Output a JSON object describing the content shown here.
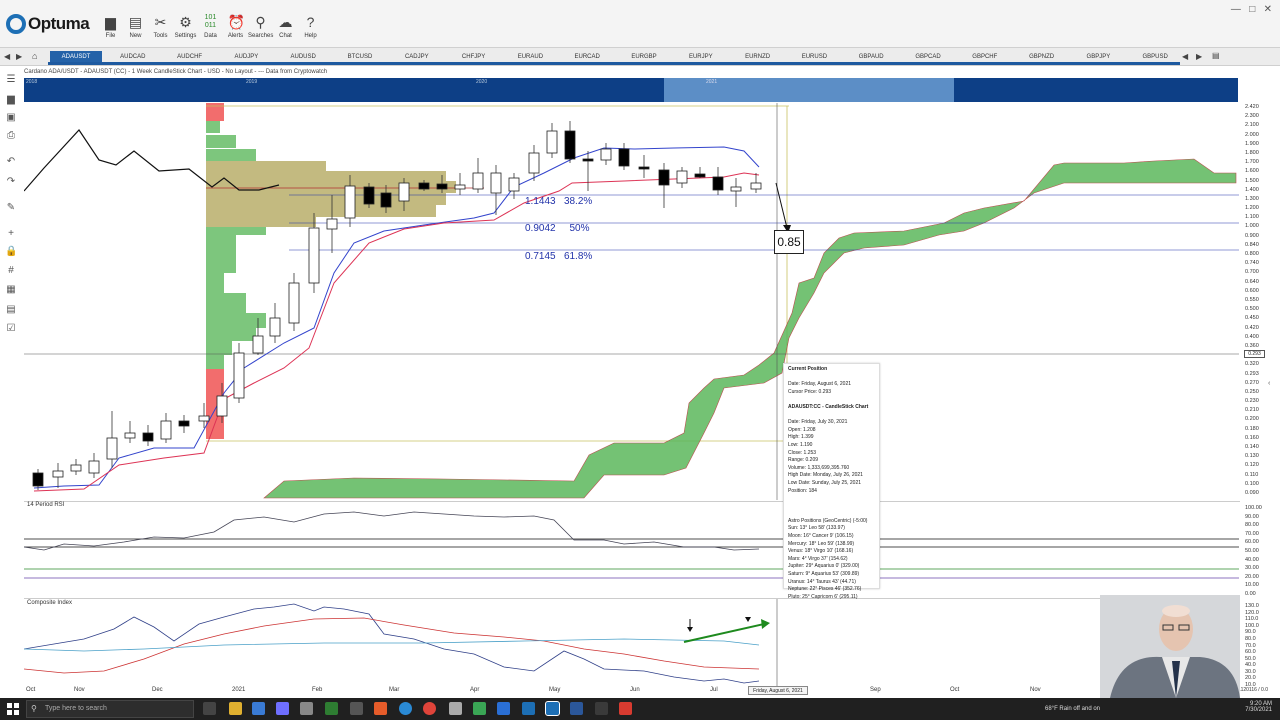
{
  "app": {
    "name": "Optuma"
  },
  "toolbar": [
    {
      "label": "File",
      "icon": "folder-icon"
    },
    {
      "label": "New",
      "icon": "new-document-icon"
    },
    {
      "label": "Tools",
      "icon": "tools-icon"
    },
    {
      "label": "Settings",
      "icon": "gear-icon"
    },
    {
      "label": "Data",
      "icon": "data-icon"
    },
    {
      "label": "Alerts",
      "icon": "alarm-icon"
    },
    {
      "label": "Searches",
      "icon": "search-icon"
    },
    {
      "label": "Chat",
      "icon": "chat-icon"
    },
    {
      "label": "Help",
      "icon": "help-icon"
    }
  ],
  "tabs": [
    "ADAUSDT",
    "AUDCAD",
    "AUDCHF",
    "AUDJPY",
    "AUDUSD",
    "BTCUSD",
    "CADJPY",
    "CHFJPY",
    "EURAUD",
    "EURCAD",
    "EURGBP",
    "EURJPY",
    "EURNZD",
    "EURUSD",
    "GBPAUD",
    "GBPCAD",
    "GBPCHF",
    "GBPNZD",
    "GBPJPY",
    "GBPUSD"
  ],
  "chart": {
    "title": "Cardano ADA/USDT - ADAUSDT (CC) - 1 Week CandleStick Chart - USD - No Layout - --- Data from Cryptowatch",
    "nav_years": [
      "2018",
      "2019",
      "2020",
      "2021"
    ],
    "callout": "0.85",
    "current_price_label": "0.293",
    "fib_levels": [
      {
        "price": "1.1443",
        "pct": "38.2%"
      },
      {
        "price": "0.9042",
        "pct": "50%"
      },
      {
        "price": "0.7145",
        "pct": "61.8%"
      }
    ],
    "price_axis": [
      "2.420",
      "2.300",
      "2.100",
      "2.000",
      "1.900",
      "1.800",
      "1.700",
      "1.600",
      "1.500",
      "1.400",
      "1.300",
      "1.200",
      "1.100",
      "1.000",
      "0.900",
      "0.840",
      "0.800",
      "0.740",
      "0.700",
      "0.640",
      "0.600",
      "0.550",
      "0.500",
      "0.450",
      "0.420",
      "0.400",
      "0.360",
      "0.340",
      "0.320",
      "0.293",
      "0.270",
      "0.250",
      "0.230",
      "0.210",
      "0.200",
      "0.180",
      "0.160",
      "0.140",
      "0.130",
      "0.120",
      "0.110",
      "0.100",
      "0.090"
    ],
    "x_axis": [
      "Oct",
      "Nov",
      "Dec",
      "2021",
      "Feb",
      "Mar",
      "Apr",
      "May",
      "Jun",
      "Jul",
      "Aug",
      "Sep",
      "Oct",
      "Nov",
      "Dec"
    ],
    "cursor_date": "Friday, August 6, 2021",
    "corner_readout": "0.1120116 / 0.0"
  },
  "rsi": {
    "title": "14 Period RSI",
    "axis": [
      "100.00",
      "90.00",
      "80.00",
      "70.00",
      "60.00",
      "50.00",
      "40.00",
      "30.00",
      "20.00",
      "10.00",
      "0.00"
    ]
  },
  "composite": {
    "title": "Composite Index",
    "axis": [
      "130.0",
      "120.0",
      "110.0",
      "100.0",
      "90.0",
      "80.0",
      "70.0",
      "60.0",
      "50.0",
      "40.0",
      "30.0",
      "20.0",
      "10.0"
    ]
  },
  "infobox": {
    "lines": [
      {
        "t": "Current Position",
        "h": true
      },
      {
        "t": "",
        "h": false
      },
      {
        "t": "Date: Friday, August 6, 2021",
        "h": false
      },
      {
        "t": "Cursor Price: 0.293",
        "h": false
      },
      {
        "t": "",
        "h": false
      },
      {
        "t": "ADAUSDT:CC - CandleStick Chart",
        "h": true
      },
      {
        "t": "",
        "h": false
      },
      {
        "t": "Date: Friday, July 30, 2021",
        "h": false
      },
      {
        "t": "Open: 1.208",
        "h": false
      },
      {
        "t": "High: 1.399",
        "h": false
      },
      {
        "t": "Low: 1.190",
        "h": false
      },
      {
        "t": "Close: 1.253",
        "h": false
      },
      {
        "t": "Range: 0.209",
        "h": false
      },
      {
        "t": "Volume: 1,333,699,395.760",
        "h": false
      },
      {
        "t": "High Date: Monday, July 26, 2021",
        "h": false
      },
      {
        "t": "Low Date: Sunday, July 25, 2021",
        "h": false
      },
      {
        "t": "Position: 184",
        "h": false
      },
      {
        "t": "",
        "h": false
      },
      {
        "t": "",
        "h": false
      },
      {
        "t": "",
        "h": false
      },
      {
        "t": "Astro Positions (GeoCentric) (-5:00)",
        "h": false
      },
      {
        "t": "Sun: 13° Leo 58' (133.97)",
        "h": false
      },
      {
        "t": "Moon: 16° Cancer 9' (106.15)",
        "h": false
      },
      {
        "t": "Mercury: 18° Leo 59' (138.99)",
        "h": false
      },
      {
        "t": "Venus: 18° Virgo 10' (168.16)",
        "h": false
      },
      {
        "t": "Mars: 4° Virgo 37' (154.62)",
        "h": false
      },
      {
        "t": "Jupiter: 29° Aquarius 0' (329.00)",
        "h": false
      },
      {
        "t": "Saturn: 9° Aquarius 53' (309.89)",
        "h": false
      },
      {
        "t": "Uranus: 14° Taurus 43' (44.71)",
        "h": false
      },
      {
        "t": "Neptune: 22° Pisces 46' (352.76)",
        "h": false
      },
      {
        "t": "Pluto: 25° Capricorn 6' (295.11)",
        "h": false
      }
    ]
  },
  "taskbar": {
    "search_placeholder": "Type here to search",
    "weather": "68°F Rain off and on",
    "time": "9:20 AM",
    "date": "7/30/2021"
  },
  "colors": {
    "accent": "#2462a8",
    "cloud": "#5cb85c",
    "cloud_edge": "#b03030",
    "volume_red": "#f26d6d",
    "volume_olive": "#b8ae6a"
  }
}
